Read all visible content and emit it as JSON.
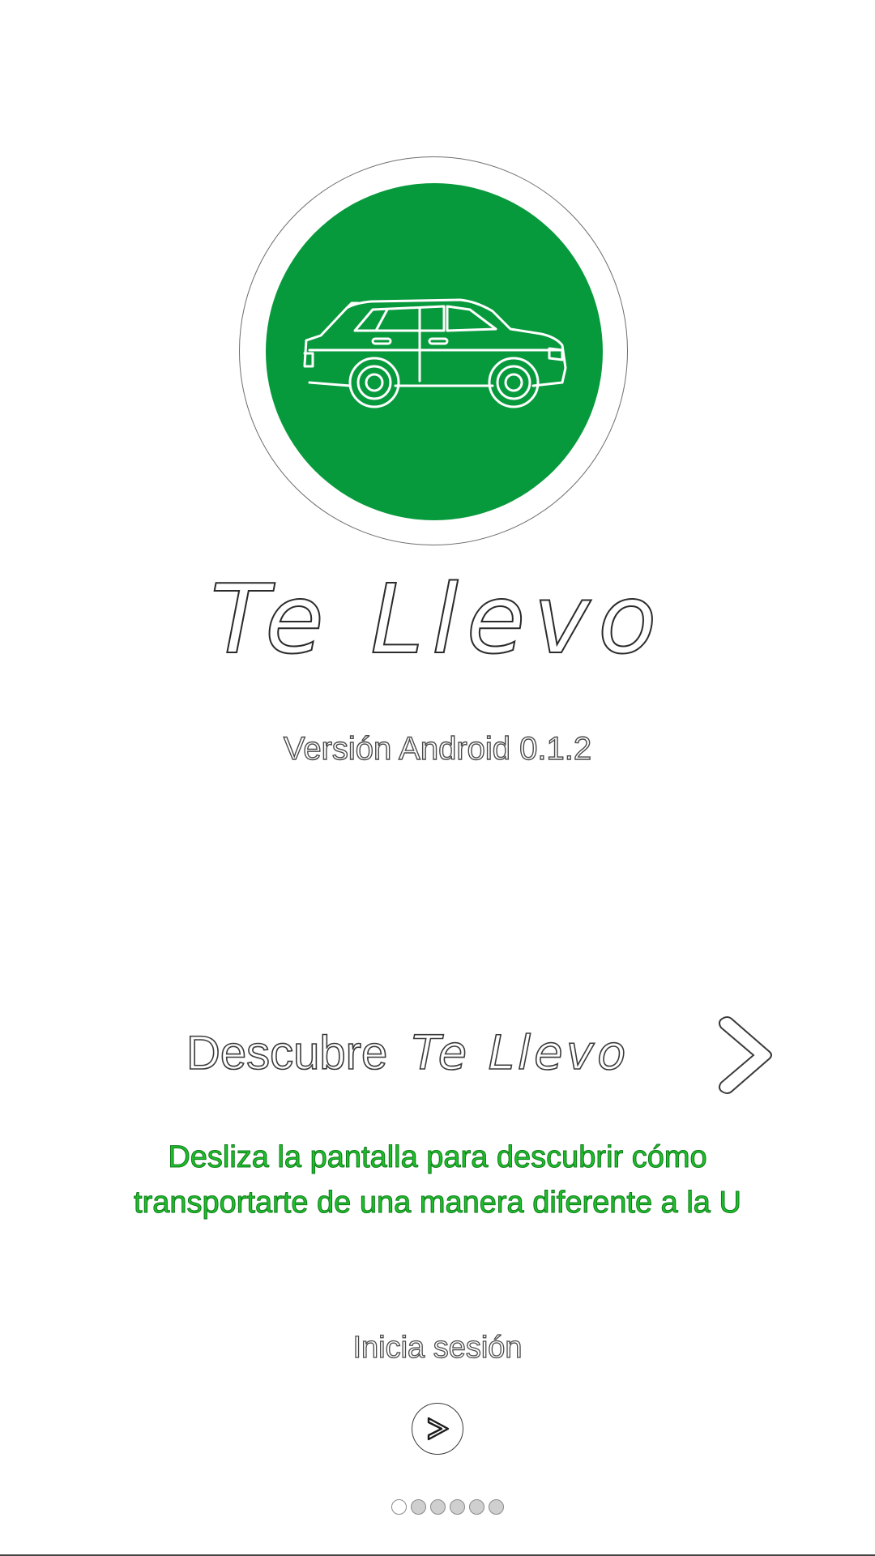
{
  "app": {
    "title": "Te Llevo",
    "version": "Versión Android 0.1.2",
    "logo_icon": "car-icon",
    "brand_color": "#079a3c"
  },
  "discover": {
    "prefix": "Descubre",
    "brand": "Te Llevo",
    "chevron_icon": "chevron-right-icon"
  },
  "description": {
    "line1": "Desliza la pantalla para descubrir cómo",
    "line2": "transportarte de una manera diferente a la U",
    "color": "#1fbf2c"
  },
  "login": {
    "label": "Inicia sesión",
    "button_icon": "arrow-right-icon"
  },
  "pager": {
    "total": 6,
    "active_index": 0
  }
}
